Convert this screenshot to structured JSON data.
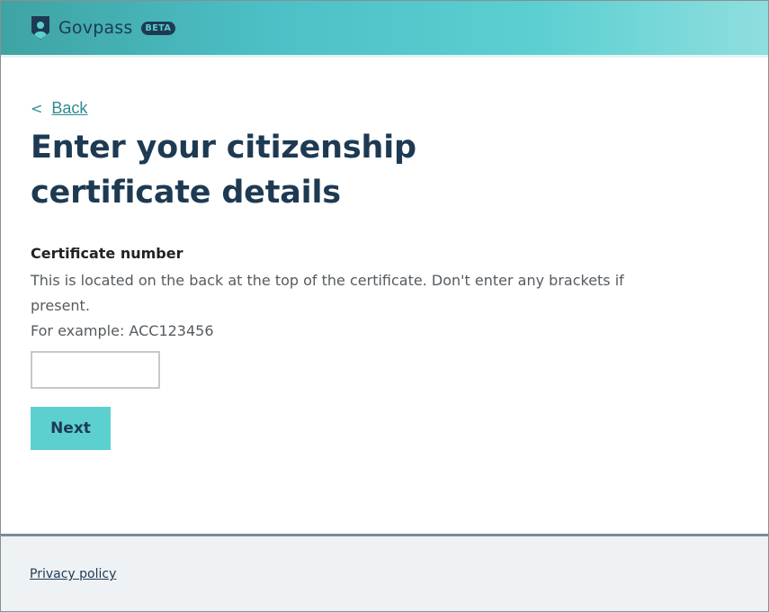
{
  "header": {
    "logo_icon": "shield-person-icon",
    "brand": "Govpass",
    "badge": "BETA",
    "colors": {
      "brand_text": "#1e3a53",
      "gradient_start": "#3fa3a3",
      "gradient_end": "#8fdede"
    }
  },
  "nav": {
    "back_chevron": "<",
    "back_label": "Back"
  },
  "main": {
    "title": "Enter your citizenship certificate details",
    "field": {
      "label": "Certificate number",
      "hint": "This is located on the back at the top of the certificate. Don't enter any brackets if present.",
      "example": "For example: ACC123456",
      "value": "",
      "placeholder": ""
    },
    "next_label": "Next",
    "colors": {
      "title": "#1e3a53",
      "button_bg": "#5ccfcf",
      "link": "#2f8b8f"
    }
  },
  "footer": {
    "privacy_label": "Privacy policy"
  }
}
